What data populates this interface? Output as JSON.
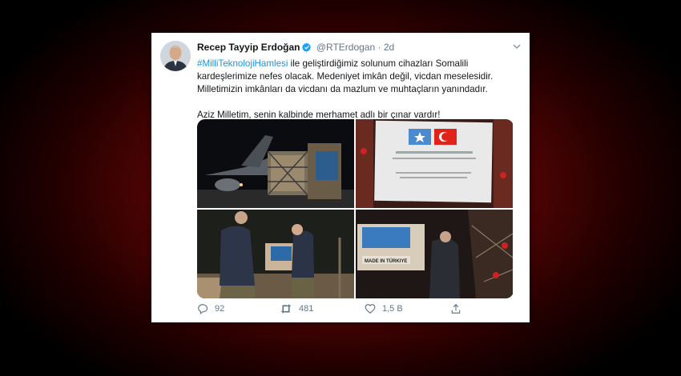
{
  "tweet": {
    "author_name": "Recep Tayyip Erdoğan",
    "handle": "@RTErdogan",
    "separator": "·",
    "time": "2d",
    "hashtag": "#MilliTeknolojiHamlesi",
    "text_after_hashtag": " ile geliştirdiğimiz solunum cihazları Somalili kardeşlerimize nefes olacak. Medeniyet imkân değil, vicdan meselesidir. Milletimizin imkânları da vicdanı da mazlum ve muhtaçların yanındadır.",
    "paragraph_2": "Aziz Milletim, senin kalbinde merhamet adlı bir çınar vardır!",
    "media": {
      "box_made_in": "MADE IN TÜRKIYE"
    },
    "actions": {
      "reply_count": "92",
      "retweet_count": "481",
      "like_count": "1,5 B"
    }
  },
  "icons": [
    "verified-badge-icon",
    "chevron-down-icon",
    "reply-icon",
    "retweet-icon",
    "like-icon",
    "share-icon"
  ],
  "colors": {
    "link": "#1b95e0",
    "verified": "#1da1f2",
    "muted": "#657786",
    "background_red": "#8c0d0d"
  }
}
